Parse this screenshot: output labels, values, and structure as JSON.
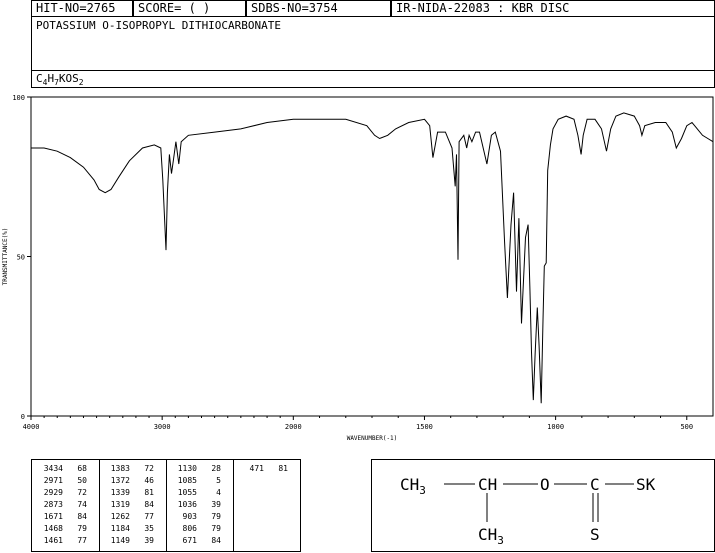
{
  "header": {
    "hit_no": "HIT-NO=2765",
    "score": "SCORE=  (   )",
    "sdbs_no": "SDBS-NO=3754",
    "ir_nida": "IR-NIDA-22083 : KBR DISC"
  },
  "compound_name": "POTASSIUM O-ISOPROPYL DITHIOCARBONATE",
  "formula": {
    "base": "C",
    "n1": "4",
    "h": "H",
    "n2": "7",
    "mid": "KOS",
    "n3": "2"
  },
  "chart_data": {
    "type": "line",
    "xlabel": "WAVENUMBER(-1)",
    "ylabel": "TRANSMITTANCE(%)",
    "xlim": [
      4000,
      400
    ],
    "ylim": [
      0,
      100
    ],
    "x_ticks": [
      4000,
      3000,
      2000,
      1500,
      1000,
      500
    ],
    "y_ticks": [
      0,
      50,
      100
    ],
    "series": [
      {
        "points": [
          [
            4000,
            84
          ],
          [
            3900,
            84
          ],
          [
            3800,
            83
          ],
          [
            3700,
            81
          ],
          [
            3600,
            78
          ],
          [
            3520,
            74
          ],
          [
            3480,
            71
          ],
          [
            3434,
            70
          ],
          [
            3390,
            71
          ],
          [
            3330,
            75
          ],
          [
            3250,
            80
          ],
          [
            3150,
            84
          ],
          [
            3060,
            85
          ],
          [
            3010,
            84
          ],
          [
            2995,
            74
          ],
          [
            2971,
            52
          ],
          [
            2960,
            70
          ],
          [
            2945,
            82
          ],
          [
            2929,
            76
          ],
          [
            2915,
            80
          ],
          [
            2895,
            86
          ],
          [
            2873,
            79
          ],
          [
            2855,
            86
          ],
          [
            2800,
            88
          ],
          [
            2600,
            89
          ],
          [
            2400,
            90
          ],
          [
            2200,
            92
          ],
          [
            2000,
            93
          ],
          [
            1800,
            93
          ],
          [
            1720,
            91
          ],
          [
            1690,
            88
          ],
          [
            1671,
            87
          ],
          [
            1640,
            88
          ],
          [
            1610,
            90
          ],
          [
            1560,
            92
          ],
          [
            1500,
            93
          ],
          [
            1480,
            91
          ],
          [
            1468,
            81
          ],
          [
            1461,
            84
          ],
          [
            1450,
            89
          ],
          [
            1420,
            89
          ],
          [
            1395,
            84
          ],
          [
            1383,
            72
          ],
          [
            1378,
            82
          ],
          [
            1372,
            49
          ],
          [
            1368,
            86
          ],
          [
            1350,
            88
          ],
          [
            1339,
            84
          ],
          [
            1330,
            88
          ],
          [
            1319,
            86
          ],
          [
            1305,
            89
          ],
          [
            1290,
            89
          ],
          [
            1262,
            79
          ],
          [
            1245,
            88
          ],
          [
            1230,
            89
          ],
          [
            1210,
            83
          ],
          [
            1195,
            55
          ],
          [
            1184,
            37
          ],
          [
            1170,
            60
          ],
          [
            1160,
            70
          ],
          [
            1149,
            39
          ],
          [
            1140,
            62
          ],
          [
            1130,
            29
          ],
          [
            1115,
            56
          ],
          [
            1105,
            60
          ],
          [
            1098,
            40
          ],
          [
            1092,
            20
          ],
          [
            1085,
            5
          ],
          [
            1078,
            20
          ],
          [
            1070,
            34
          ],
          [
            1063,
            22
          ],
          [
            1055,
            4
          ],
          [
            1048,
            30
          ],
          [
            1043,
            47
          ],
          [
            1036,
            48
          ],
          [
            1030,
            77
          ],
          [
            1020,
            85
          ],
          [
            1010,
            90
          ],
          [
            990,
            93
          ],
          [
            960,
            94
          ],
          [
            930,
            93
          ],
          [
            915,
            88
          ],
          [
            903,
            82
          ],
          [
            895,
            88
          ],
          [
            880,
            93
          ],
          [
            850,
            93
          ],
          [
            825,
            90
          ],
          [
            806,
            83
          ],
          [
            790,
            90
          ],
          [
            770,
            94
          ],
          [
            740,
            95
          ],
          [
            700,
            94
          ],
          [
            680,
            91
          ],
          [
            671,
            88
          ],
          [
            660,
            91
          ],
          [
            620,
            92
          ],
          [
            580,
            92
          ],
          [
            555,
            89
          ],
          [
            540,
            84
          ],
          [
            520,
            87
          ],
          [
            500,
            91
          ],
          [
            480,
            92
          ],
          [
            460,
            90
          ],
          [
            440,
            88
          ],
          [
            420,
            87
          ],
          [
            400,
            86
          ]
        ]
      }
    ]
  },
  "peak_table": [
    {
      "wn": "3434",
      "t": "68"
    },
    {
      "wn": "2971",
      "t": "50"
    },
    {
      "wn": "2929",
      "t": "72"
    },
    {
      "wn": "2873",
      "t": "74"
    },
    {
      "wn": "1671",
      "t": "84"
    },
    {
      "wn": "1468",
      "t": "79"
    },
    {
      "wn": "1461",
      "t": "77"
    },
    {
      "wn": "1383",
      "t": "72"
    },
    {
      "wn": "1372",
      "t": "46"
    },
    {
      "wn": "1339",
      "t": "81"
    },
    {
      "wn": "1319",
      "t": "84"
    },
    {
      "wn": "1262",
      "t": "77"
    },
    {
      "wn": "1184",
      "t": "35"
    },
    {
      "wn": "1149",
      "t": "39"
    },
    {
      "wn": "1130",
      "t": "28"
    },
    {
      "wn": "1085",
      "t": "5"
    },
    {
      "wn": "1055",
      "t": "4"
    },
    {
      "wn": "1036",
      "t": "39"
    },
    {
      "wn": "903",
      "t": "79"
    },
    {
      "wn": "806",
      "t": "79"
    },
    {
      "wn": "671",
      "t": "84"
    },
    {
      "wn": "471",
      "t": "81"
    }
  ],
  "structure": {
    "ch3_left": "CH",
    "ch3_left_sub": "3",
    "ch": "CH",
    "o": "O",
    "c": "C",
    "sk": "SK",
    "s": "S",
    "ch3_bottom": "CH",
    "ch3_bottom_sub": "3"
  }
}
